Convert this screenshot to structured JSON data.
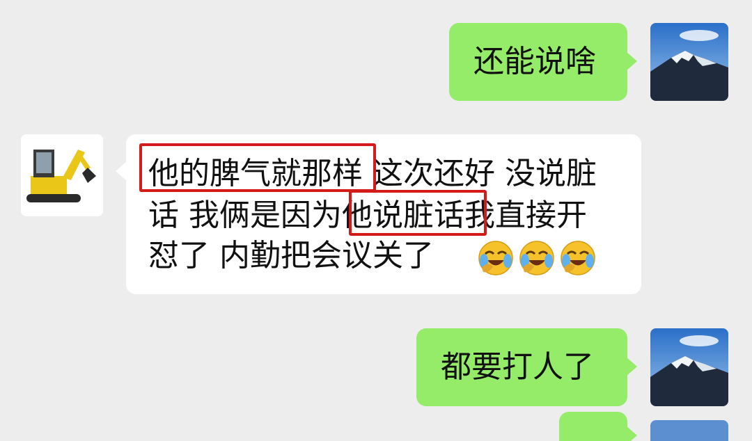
{
  "messages": [
    {
      "side": "right",
      "text": "还能说啥"
    },
    {
      "side": "left",
      "lines": [
        "他的脾气就那样 这次还好 没说脏",
        "话 我俩是因为他说脏话我直接开",
        "怼了 内勤把会议关了"
      ],
      "emojis": [
        "crying-laughing-emoji",
        "crying-laughing-emoji",
        "crying-laughing-emoji"
      ],
      "highlights": [
        "他的脾气就那样",
        "他说脏话"
      ]
    },
    {
      "side": "right",
      "text": "都要打人了"
    }
  ],
  "colors": {
    "background": "#ededed",
    "sent_bubble": "#95ec69",
    "received_bubble": "#ffffff",
    "highlight_box": "#d51a1a"
  }
}
